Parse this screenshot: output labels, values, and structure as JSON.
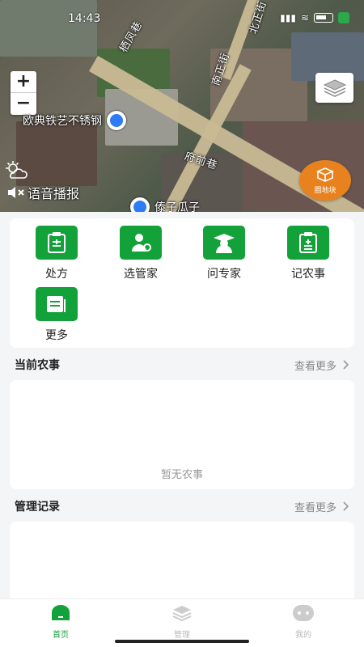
{
  "status_bar": {
    "time": "14:43"
  },
  "map": {
    "roads": [
      "北正街",
      "南正街",
      "府前巷",
      "栖凤巷"
    ],
    "poi_top": "欧典铁艺不锈钢",
    "poi_bottom": "傣子瓜子",
    "zoom_in": "+",
    "zoom_out": "−",
    "voice_label": "语音播报",
    "circle_label": "圈地块"
  },
  "menu": {
    "items": [
      {
        "label": "处方",
        "icon": "prescription-icon"
      },
      {
        "label": "选管家",
        "icon": "manager-icon"
      },
      {
        "label": "问专家",
        "icon": "expert-icon"
      },
      {
        "label": "记农事",
        "icon": "record-icon"
      },
      {
        "label": "更多",
        "icon": "more-icon"
      }
    ]
  },
  "current_farming": {
    "title": "当前农事",
    "more": "查看更多",
    "empty": "暂无农事"
  },
  "records": {
    "title": "管理记录",
    "more": "查看更多"
  },
  "bottom_nav": {
    "items": [
      {
        "label": "首页",
        "active": true
      },
      {
        "label": "管理",
        "active": false
      },
      {
        "label": "我的",
        "active": false
      }
    ]
  },
  "colors": {
    "accent": "#13a23a",
    "orange": "#e8821e"
  }
}
